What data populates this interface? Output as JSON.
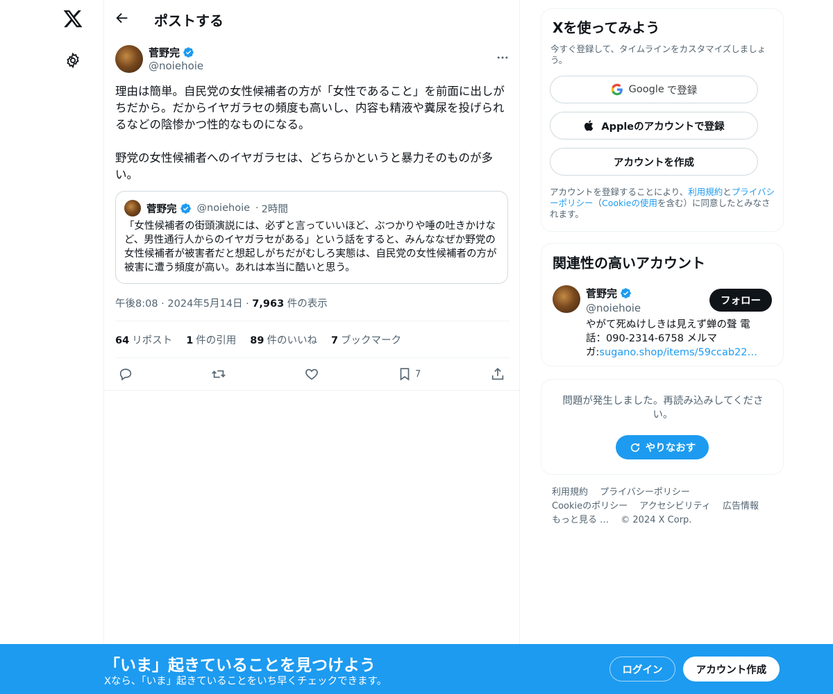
{
  "header": {
    "title": "ポストする"
  },
  "post": {
    "author_name": "菅野完",
    "author_handle": "@noiehoie",
    "text": "理由は簡単。自民党の女性候補者の方が「女性であること」を前面に出しがちだから。だからイヤガラセの頻度も高いし、内容も精液や糞尿を投げられるなどの陰惨かつ性的なものになる。\n\n野党の女性候補者へのイヤガラセは、どちらかというと暴力そのものが多い。",
    "quote": {
      "author_name": "菅野完",
      "author_handle": "@noiehoie",
      "time": "2時間",
      "text": "「女性候補者の街頭演説には、必ずと言っていいほど、ぶつかりや唾の吐きかけなど、男性通行人からのイヤガラセがある」という話をすると、みんななぜか野党の女性候補者が被害者だと想起しがちだがむしろ実態は、自民党の女性候補者の方が被害に遭う頻度が高い。あれは本当に酷いと思う。"
    },
    "time": "午後8:08",
    "date": "2024年5月14日",
    "views_count": "7,963",
    "views_label": "件の表示",
    "stats": {
      "reposts_count": "64",
      "reposts_label": "リポスト",
      "quotes_count": "1",
      "quotes_label": "件の引用",
      "likes_count": "89",
      "likes_label": "件のいいね",
      "bookmarks_count": "7",
      "bookmarks_label": "ブックマーク"
    },
    "bookmark_action_count": "7"
  },
  "signup": {
    "title": "Xを使ってみよう",
    "subtitle": "今すぐ登録して、タイムラインをカスタマイズしましょう。",
    "google_brand": "Google",
    "google_label": "で登録",
    "apple_label": "Appleのアカウントで登録",
    "create_label": "アカウントを作成",
    "terms_prefix": "アカウントを登録することにより、",
    "terms_link": "利用規約",
    "terms_and": "と",
    "privacy_link": "プライバシーポリシー",
    "terms_open": "（",
    "cookie_link": "Cookieの使用",
    "terms_suffix": "を含む）に同意したとみなされます。"
  },
  "related": {
    "title": "関連性の高いアカウント",
    "name": "菅野完",
    "handle": "@noiehoie",
    "follow_label": "フォロー",
    "bio_text": "やがて死ぬけしきは見えず蝉の聲 電話：090-2314-6758 メルマガ:",
    "bio_link": "sugano.shop/items/59ccab22…"
  },
  "error": {
    "message": "問題が発生しました。再読み込みしてください。",
    "retry_label": "やりなおす"
  },
  "footer": {
    "terms": "利用規約",
    "privacy": "プライバシーポリシー",
    "cookie": "Cookieのポリシー",
    "accessibility": "アクセシビリティ",
    "ads": "広告情報",
    "more": "もっと見る …",
    "copyright": "© 2024 X Corp."
  },
  "banner": {
    "title": "「いま」起きていることを見つけよう",
    "subtitle": "Xなら、「いま」起きていることをいち早くチェックできます。",
    "login_label": "ログイン",
    "create_label": "アカウント作成"
  },
  "colors": {
    "accent": "#1d9bf0",
    "text": "#0f1419",
    "muted": "#536471",
    "border": "#eff3f4"
  },
  "icons": [
    "x-logo-icon",
    "settings-gear-icon",
    "back-arrow-icon",
    "verified-badge-icon",
    "more-dots-icon",
    "reply-icon",
    "repost-icon",
    "like-icon",
    "bookmark-icon",
    "share-icon",
    "google-icon",
    "apple-icon",
    "refresh-icon"
  ]
}
